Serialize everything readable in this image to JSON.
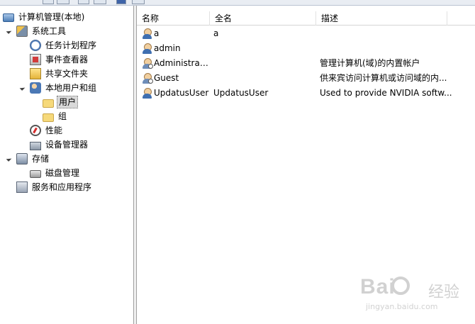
{
  "tree": {
    "root": {
      "label": "计算机管理(本地)",
      "icon": "computer-management-icon"
    },
    "system_tools": {
      "label": "系统工具",
      "icon": "system-tools-icon"
    },
    "task_scheduler": {
      "label": "任务计划程序",
      "icon": "clock-icon"
    },
    "event_viewer": {
      "label": "事件查看器",
      "icon": "event-viewer-icon"
    },
    "shared_folders": {
      "label": "共享文件夹",
      "icon": "shared-folder-icon"
    },
    "local_users": {
      "label": "本地用户和组",
      "icon": "users-icon"
    },
    "users": {
      "label": "用户",
      "icon": "folder-icon",
      "selected": true
    },
    "groups": {
      "label": "组",
      "icon": "folder-icon"
    },
    "performance": {
      "label": "性能",
      "icon": "performance-icon"
    },
    "device_manager": {
      "label": "设备管理器",
      "icon": "device-manager-icon"
    },
    "storage": {
      "label": "存储",
      "icon": "storage-icon"
    },
    "disk_management": {
      "label": "磁盘管理",
      "icon": "disk-icon"
    },
    "services": {
      "label": "服务和应用程序",
      "icon": "services-icon"
    }
  },
  "list": {
    "columns": {
      "name": "名称",
      "fullname": "全名",
      "description": "描述"
    },
    "rows": [
      {
        "name": "a",
        "fullname": "a",
        "description": "",
        "disabled": false
      },
      {
        "name": "admin",
        "fullname": "",
        "description": "",
        "disabled": false
      },
      {
        "name": "Administrat...",
        "fullname": "",
        "description": "管理计算机(域)的内置帐户",
        "disabled": true
      },
      {
        "name": "Guest",
        "fullname": "",
        "description": "供来宾访问计算机或访问域的内...",
        "disabled": true
      },
      {
        "name": "UpdatusUser",
        "fullname": "UpdatusUser",
        "description": "Used to provide NVIDIA softw...",
        "disabled": false
      }
    ]
  },
  "watermark": {
    "logo": "Bai",
    "logo2": "经验",
    "url": "jingyan.baidu.com"
  }
}
